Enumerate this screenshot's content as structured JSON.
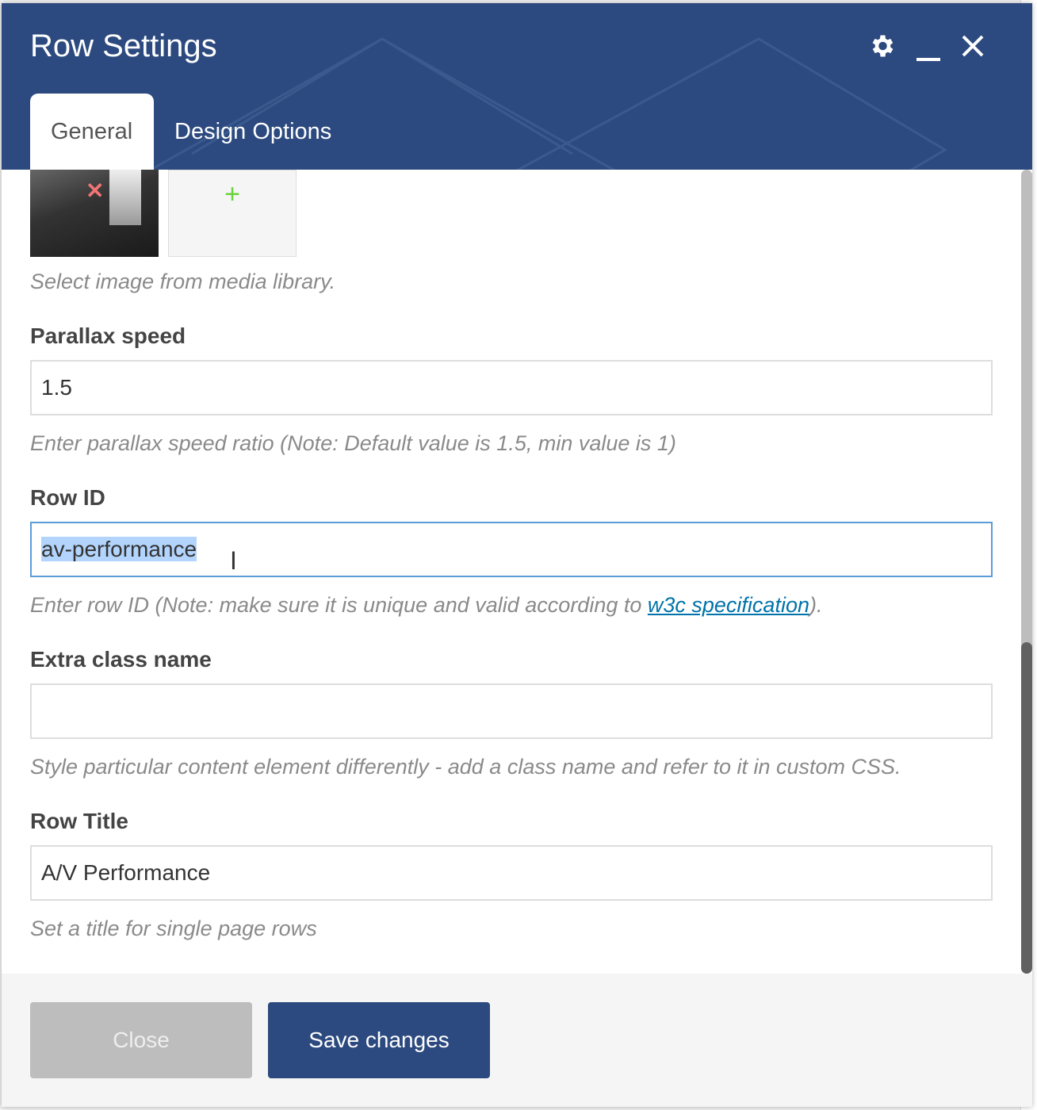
{
  "modal": {
    "title": "Row Settings",
    "icons": [
      "gear-icon",
      "minimize-icon",
      "close-icon"
    ],
    "tabs": [
      {
        "label": "General",
        "active": true
      },
      {
        "label": "Design Options",
        "active": false
      }
    ]
  },
  "fields": {
    "image_help": "Select image from media library.",
    "parallax": {
      "label": "Parallax speed",
      "value": "1.5",
      "help": "Enter parallax speed ratio (Note: Default value is 1.5, min value is 1)"
    },
    "row_id": {
      "label": "Row ID",
      "value": "av-performance",
      "help_before": "Enter row ID (Note: make sure it is unique and valid according to ",
      "help_link": "w3c specification",
      "help_after": ")."
    },
    "extra_class": {
      "label": "Extra class name",
      "value": "",
      "help": "Style particular content element differently - add a class name and refer to it in custom CSS."
    },
    "row_title": {
      "label": "Row Title",
      "value": "A/V Performance",
      "help": "Set a title for single page rows"
    }
  },
  "footer": {
    "close_label": "Close",
    "save_label": "Save changes"
  },
  "colors": {
    "header": "#2c4a7f",
    "focus_border": "#5b9dd9",
    "link": "#0073aa"
  }
}
